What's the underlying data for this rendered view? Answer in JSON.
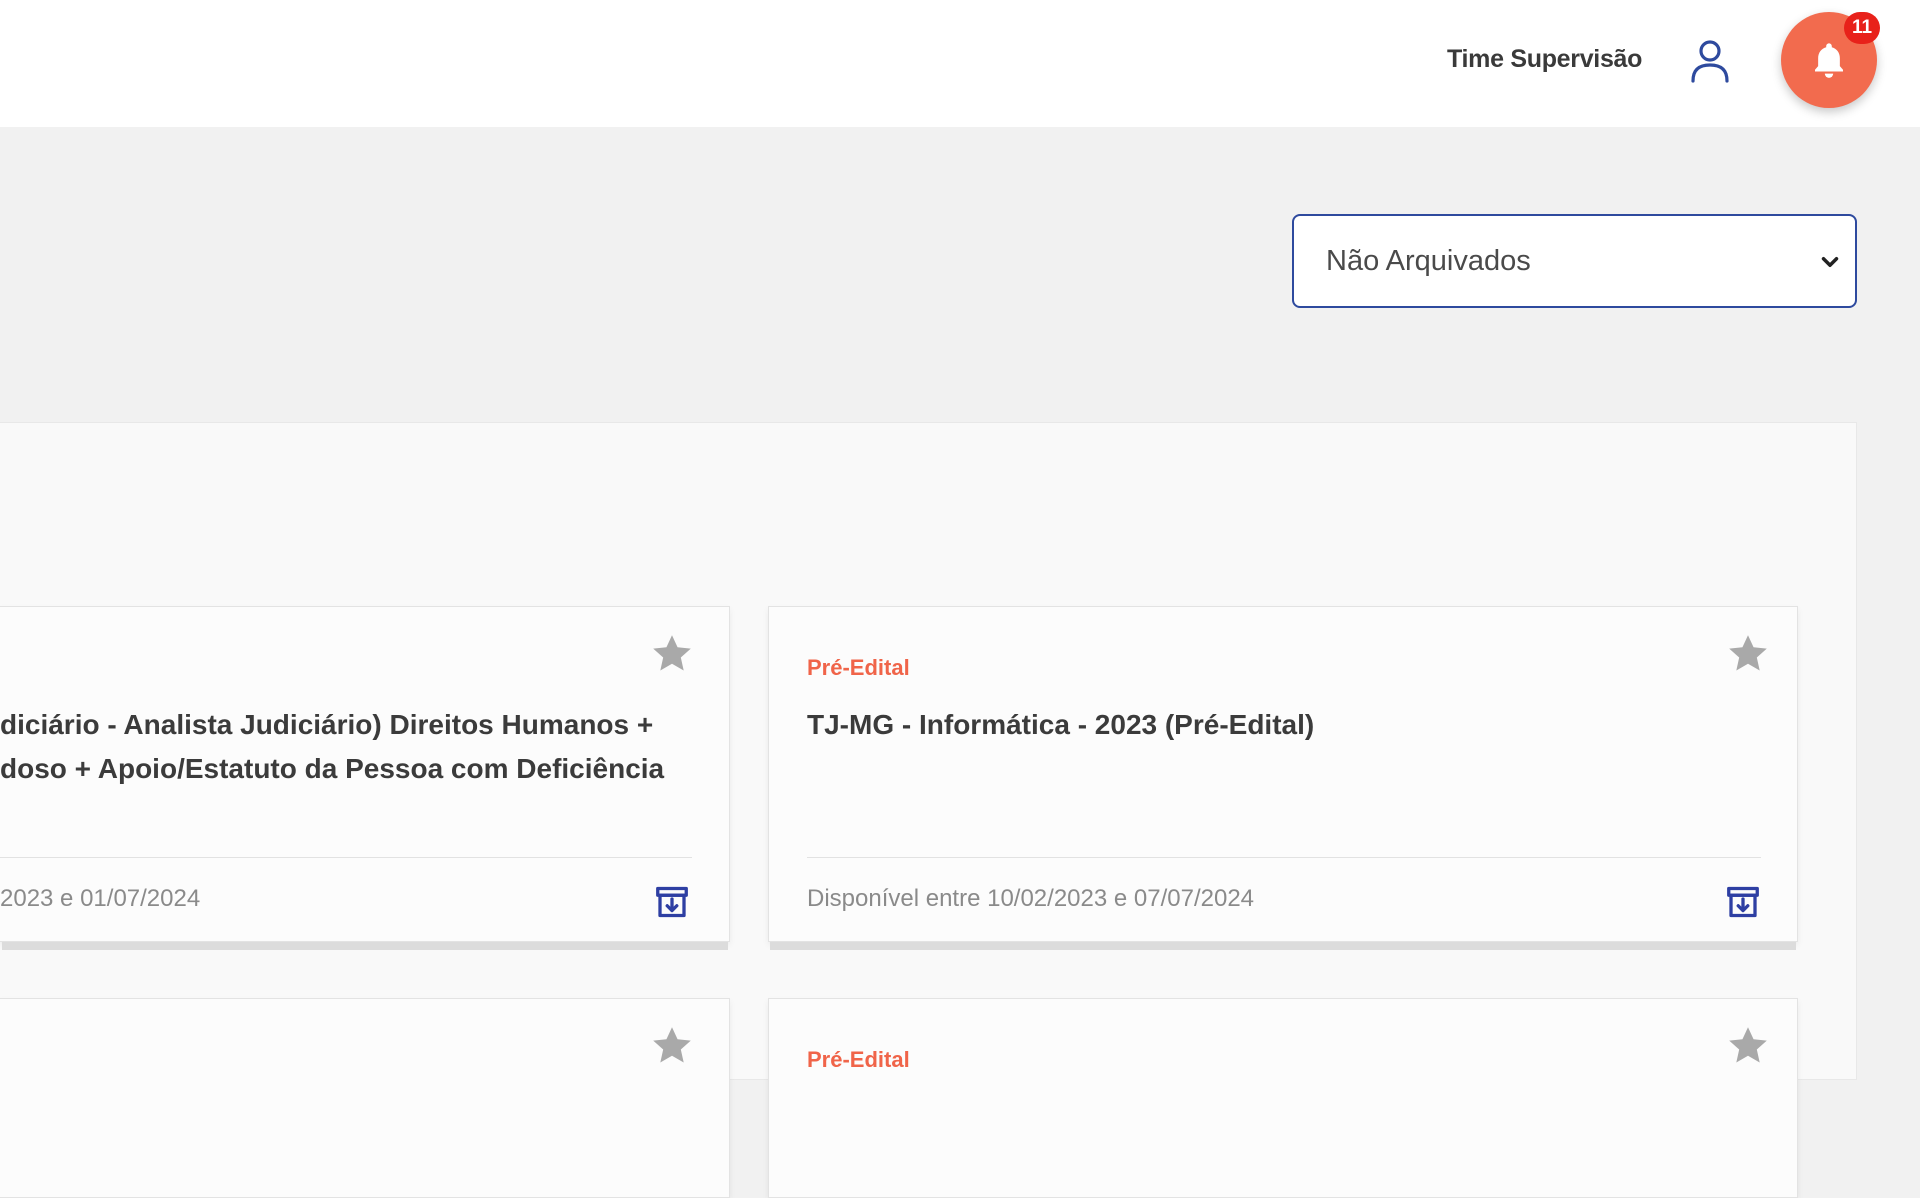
{
  "header": {
    "user_name": "Time Supervisão",
    "notifications_count": "11",
    "icons": [
      "user-icon",
      "bell-icon"
    ]
  },
  "filter": {
    "selected": "Não Arquivados"
  },
  "cards": [
    {
      "tag": "",
      "title_line1": "diciário - Analista Judiciário) Direitos Humanos +",
      "title_line2": "doso + Apoio/Estatuto da Pessoa com Deficiência",
      "availability": "2023 e 01/07/2024"
    },
    {
      "tag": "Pré-Edital",
      "title_line1": "TJ-MG - Informática - 2023 (Pré-Edital)",
      "title_line2": "",
      "availability": "Disponível entre 10/02/2023 e 07/07/2024"
    },
    {
      "tag": "",
      "title_line1": "",
      "title_line2": "",
      "availability": ""
    },
    {
      "tag": "Pré-Edital",
      "title_line1": "",
      "title_line2": "",
      "availability": ""
    }
  ],
  "colors": {
    "accent": "#f26b4e",
    "badge": "#e8211a",
    "primary_blue": "#2e4a9e",
    "tag": "#f06449"
  }
}
